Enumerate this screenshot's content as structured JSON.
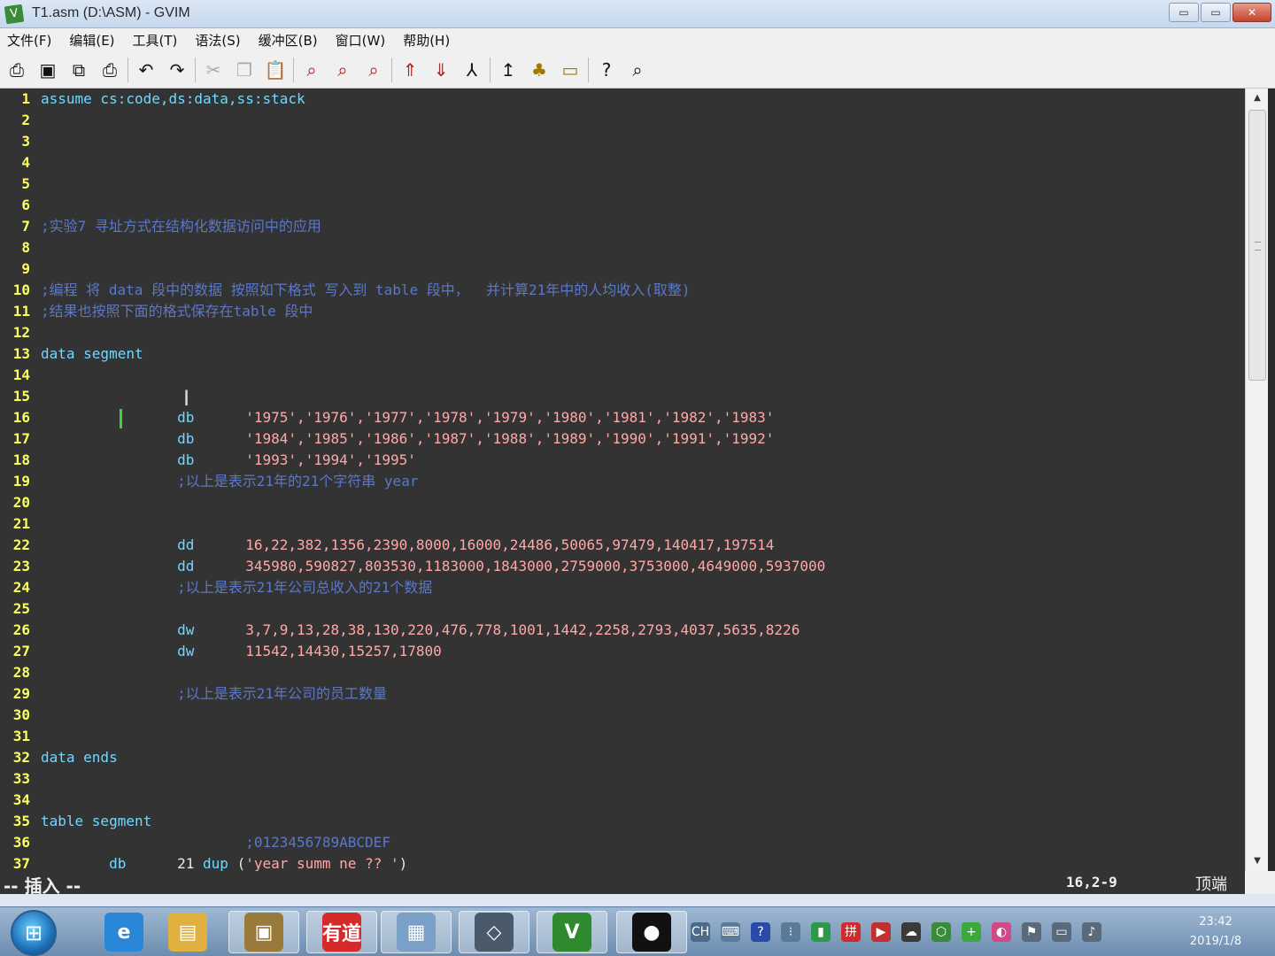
{
  "window": {
    "title": "T1.asm (D:\\ASM) - GVIM",
    "minimize": "▭",
    "maximize": "▭",
    "close": "✕"
  },
  "menu": [
    "文件(F)",
    "编辑(E)",
    "工具(T)",
    "语法(S)",
    "缓冲区(B)",
    "窗口(W)",
    "帮助(H)"
  ],
  "toolbar": {
    "icons": [
      "open-icon",
      "save-icon",
      "save-all-icon",
      "print-icon",
      "undo-icon",
      "redo-icon",
      "cut-icon",
      "copy-icon",
      "paste-icon",
      "find-replace-icon",
      "find-next-icon",
      "find-prev-icon",
      "load-session-icon",
      "save-session-icon",
      "run-script-icon",
      "make-icon",
      "shell-icon",
      "ctags-icon",
      "help-icon",
      "find-help-icon"
    ]
  },
  "lines": [
    {
      "n": "1",
      "segs": [
        [
          "kw",
          "assume cs:code,ds:data,ss:stack"
        ]
      ]
    },
    {
      "n": "2",
      "segs": []
    },
    {
      "n": "3",
      "segs": []
    },
    {
      "n": "4",
      "segs": []
    },
    {
      "n": "5",
      "segs": []
    },
    {
      "n": "6",
      "segs": []
    },
    {
      "n": "7",
      "segs": [
        [
          "cm",
          ";实验7 寻址方式在结构化数据访问中的应用"
        ]
      ]
    },
    {
      "n": "8",
      "segs": []
    },
    {
      "n": "9",
      "segs": []
    },
    {
      "n": "10",
      "segs": [
        [
          "cm",
          ";编程 将 data 段中的数据 按照如下格式 写入到 table 段中，  并计算21年中的人均收入(取整)"
        ]
      ]
    },
    {
      "n": "11",
      "segs": [
        [
          "cm",
          ";结果也按照下面的格式保存在table 段中"
        ]
      ]
    },
    {
      "n": "12",
      "segs": []
    },
    {
      "n": "13",
      "segs": [
        [
          "kw",
          "data segment"
        ]
      ]
    },
    {
      "n": "14",
      "segs": []
    },
    {
      "n": "15",
      "segs": []
    },
    {
      "n": "16",
      "segs": [
        [
          "tx",
          "                "
        ],
        [
          "kw",
          "db"
        ],
        [
          "tx",
          "      "
        ],
        [
          "str",
          "'1975','1976','1977','1978','1979','1980','1981','1982','1983'"
        ]
      ]
    },
    {
      "n": "17",
      "segs": [
        [
          "tx",
          "                "
        ],
        [
          "kw",
          "db"
        ],
        [
          "tx",
          "      "
        ],
        [
          "str",
          "'1984','1985','1986','1987','1988','1989','1990','1991','1992'"
        ]
      ]
    },
    {
      "n": "18",
      "segs": [
        [
          "tx",
          "                "
        ],
        [
          "kw",
          "db"
        ],
        [
          "tx",
          "      "
        ],
        [
          "str",
          "'1993','1994','1995'"
        ]
      ]
    },
    {
      "n": "19",
      "segs": [
        [
          "tx",
          "                "
        ],
        [
          "cm",
          ";以上是表示21年的21个字符串 year"
        ]
      ]
    },
    {
      "n": "20",
      "segs": []
    },
    {
      "n": "21",
      "segs": []
    },
    {
      "n": "22",
      "segs": [
        [
          "tx",
          "                "
        ],
        [
          "kw",
          "dd"
        ],
        [
          "tx",
          "      "
        ],
        [
          "num",
          "16,22,382,1356,2390,8000,16000,24486,50065,97479,140417,197514"
        ]
      ]
    },
    {
      "n": "23",
      "segs": [
        [
          "tx",
          "                "
        ],
        [
          "kw",
          "dd"
        ],
        [
          "tx",
          "      "
        ],
        [
          "num",
          "345980,590827,803530,1183000,1843000,2759000,3753000,4649000,5937000"
        ]
      ]
    },
    {
      "n": "24",
      "segs": [
        [
          "tx",
          "                "
        ],
        [
          "cm",
          ";以上是表示21年公司总收入的21个数据"
        ]
      ]
    },
    {
      "n": "25",
      "segs": []
    },
    {
      "n": "26",
      "segs": [
        [
          "tx",
          "                "
        ],
        [
          "kw",
          "dw"
        ],
        [
          "tx",
          "      "
        ],
        [
          "num",
          "3,7,9,13,28,38,130,220,476,778,1001,1442,2258,2793,4037,5635,8226"
        ]
      ]
    },
    {
      "n": "27",
      "segs": [
        [
          "tx",
          "                "
        ],
        [
          "kw",
          "dw"
        ],
        [
          "tx",
          "      "
        ],
        [
          "num",
          "11542,14430,15257,17800"
        ]
      ]
    },
    {
      "n": "28",
      "segs": []
    },
    {
      "n": "29",
      "segs": [
        [
          "tx",
          "                "
        ],
        [
          "cm",
          ";以上是表示21年公司的员工数量"
        ]
      ]
    },
    {
      "n": "30",
      "segs": []
    },
    {
      "n": "31",
      "segs": []
    },
    {
      "n": "32",
      "segs": [
        [
          "kw",
          "data ends"
        ]
      ]
    },
    {
      "n": "33",
      "segs": []
    },
    {
      "n": "34",
      "segs": []
    },
    {
      "n": "35",
      "segs": [
        [
          "kw",
          "table segment"
        ]
      ]
    },
    {
      "n": "36",
      "segs": [
        [
          "tx",
          "                        "
        ],
        [
          "cm",
          ";0123456789ABCDEF"
        ]
      ]
    },
    {
      "n": "37",
      "segs": [
        [
          "tx",
          "        "
        ],
        [
          "kw",
          "db"
        ],
        [
          "tx",
          "      "
        ],
        [
          "tx",
          "21 "
        ],
        [
          "kw",
          "dup"
        ],
        [
          "tx",
          " ("
        ],
        [
          "str",
          "'year summ ne ?? '"
        ],
        [
          "tx",
          ")"
        ]
      ]
    }
  ],
  "status": {
    "mode": "-- 插入 --",
    "position": "16,2-9",
    "scroll": "顶端"
  },
  "scrollbar": {
    "up": "▲",
    "down": "▼"
  },
  "taskbar": {
    "start": "⊞",
    "apps": [
      {
        "name": "ie-app",
        "glyph": "e",
        "color": "#2a86d6"
      },
      {
        "name": "explorer-app",
        "glyph": "▤",
        "color": "#e0b040"
      },
      {
        "name": "dosbox-app",
        "glyph": "▣",
        "color": "#9a7a3a"
      },
      {
        "name": "youdao-app",
        "glyph": "有道",
        "color": "#d42a2a"
      },
      {
        "name": "file-app",
        "glyph": "▦",
        "color": "#7aa0c8"
      },
      {
        "name": "box-app",
        "glyph": "◇",
        "color": "#4a5a6a"
      },
      {
        "name": "gvim-app",
        "glyph": "V",
        "color": "#2f8a2f"
      },
      {
        "name": "obs-app",
        "glyph": "●",
        "color": "#111111"
      }
    ],
    "tray": [
      "CH",
      "⌨",
      "?",
      "⁝",
      "▮",
      "拼",
      "▶",
      "☁",
      "⬡",
      "+",
      "◐",
      "⚑",
      "▭",
      "♪"
    ],
    "clock_time": "23:42",
    "clock_date": "2019/1/8"
  }
}
